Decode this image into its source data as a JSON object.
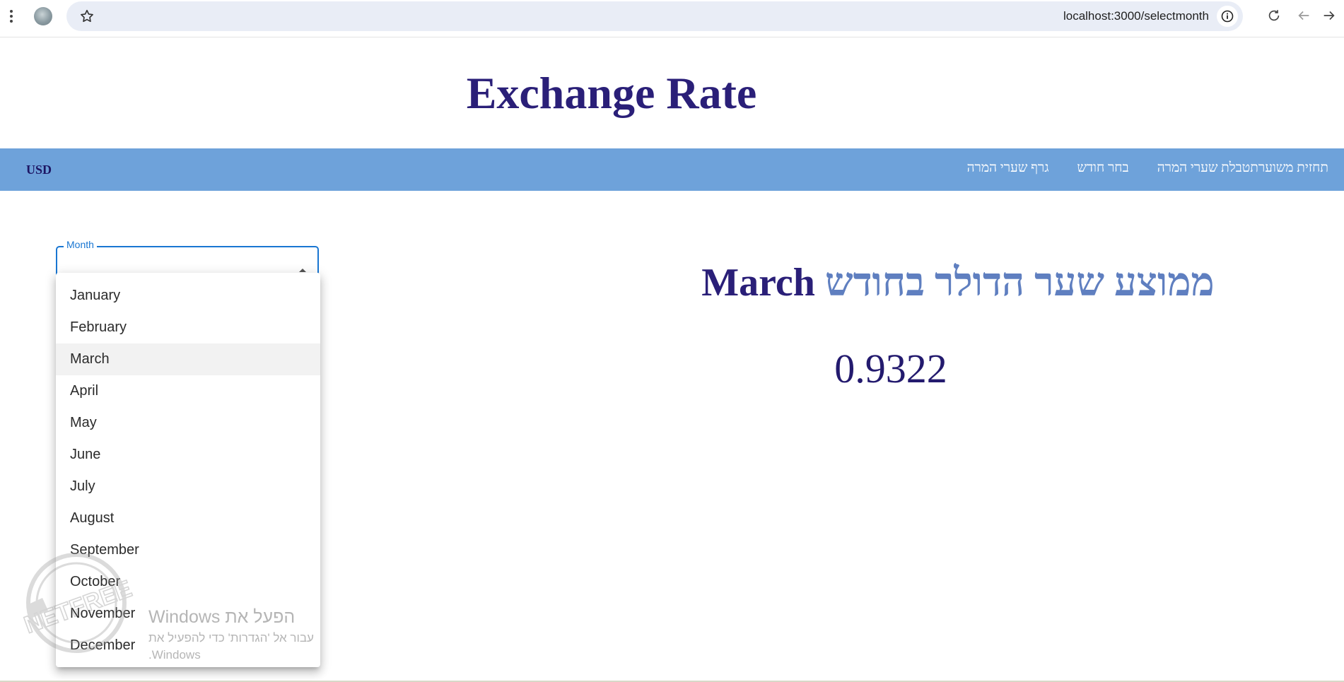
{
  "browser": {
    "url": "localhost:3000/selectmonth"
  },
  "header": {
    "title": "Exchange Rate"
  },
  "navbar": {
    "currency": "USD",
    "links": [
      {
        "label": "גרף שערי המרה"
      },
      {
        "label": "בחר חודש"
      },
      {
        "label": "טבלת שערי המרה"
      },
      {
        "label": "תחזית משוערת"
      }
    ]
  },
  "result": {
    "heading_prefix": "ממוצע שער הדולר בחודש",
    "heading_month": "March",
    "value": "0.9322"
  },
  "month_select": {
    "label": "Month",
    "selected": "March",
    "options": [
      "January",
      "February",
      "March",
      "April",
      "May",
      "June",
      "July",
      "August",
      "September",
      "October",
      "November",
      "December"
    ]
  },
  "overlay": {
    "activate_title": "הפעל את Windows",
    "activate_subtitle": "עבור אל 'הגדרות' כדי להפעיל את Windows.",
    "logo_text": "NETFREE"
  },
  "colors": {
    "navbar": "#6ea2da",
    "title": "#2a1f78",
    "select_accent": "#1976d2"
  }
}
